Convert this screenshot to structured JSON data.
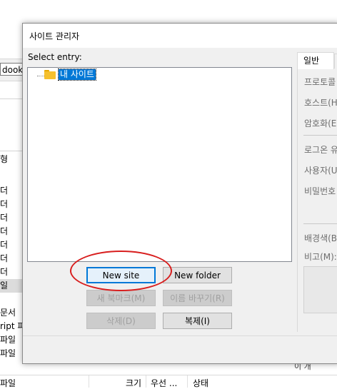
{
  "background": {
    "path_text": "dookd",
    "column_header": "형",
    "rows": [
      {
        "label": "더",
        "selected": false
      },
      {
        "label": "더",
        "selected": false
      },
      {
        "label": "더",
        "selected": false
      },
      {
        "label": "더",
        "selected": false
      },
      {
        "label": "더",
        "selected": false
      },
      {
        "label": "더",
        "selected": false
      },
      {
        "label": "더",
        "selected": false
      },
      {
        "label": "일",
        "selected": true
      }
    ],
    "rows2": [
      "문서",
      "ript 파",
      "파일",
      "파일"
    ],
    "right_sliver": "이 개",
    "bottom_headers": [
      "파일",
      "크기",
      "우선 ...",
      "상태"
    ]
  },
  "dialog": {
    "title": "사이트 관리자",
    "select_entry_label": "Select entry:",
    "tree_root_label": "내 사이트",
    "buttons": {
      "new_site": "New site",
      "new_folder": "New folder",
      "new_bookmark": "새 북마크(M)",
      "rename": "이름 바꾸기(R)",
      "delete": "삭제(D)",
      "copy": "복제(I)"
    },
    "tabs": {
      "general": "일반"
    },
    "fields": {
      "protocol": "프로토콜",
      "host": "호스트(H",
      "encryption": "암호화(E",
      "logon": "로그온 유",
      "user": "사용자(U",
      "password": "비밀번호",
      "bg_color": "배경색(B",
      "comments": "비고(M):"
    }
  },
  "colors": {
    "highlight_ellipse": "#d81e1e",
    "selection": "#0078d7",
    "folder": "#f5c02e"
  }
}
